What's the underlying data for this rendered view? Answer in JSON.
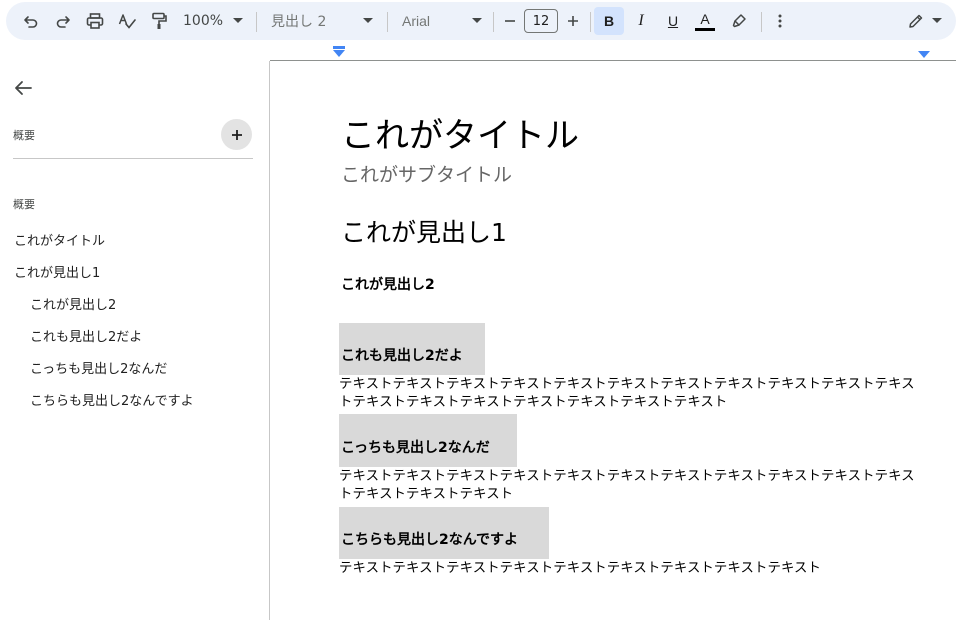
{
  "toolbar": {
    "zoom": "100%",
    "style": "見出し 2",
    "font": "Arial",
    "font_size": "12",
    "bold": "B",
    "italic": "I",
    "underline": "U",
    "text_color": "A",
    "colors": {
      "background": "#edf2fa",
      "bold_active": "#d3e3fd",
      "text_color_bar": "#000000"
    }
  },
  "sidebar": {
    "summary_heading": "概要",
    "outline_heading": "概要",
    "outline": [
      {
        "label": "これがタイトル",
        "level": 1
      },
      {
        "label": "これが見出し1",
        "level": 1
      },
      {
        "label": "これが見出し2",
        "level": 2
      },
      {
        "label": "これも見出し2だよ",
        "level": 2
      },
      {
        "label": "こっちも見出し2なんだ",
        "level": 2
      },
      {
        "label": "こちらも見出し2なんですよ",
        "level": 2
      }
    ]
  },
  "document": {
    "title": "これがタイトル",
    "subtitle": "これがサブタイトル",
    "heading1": "これが見出し1",
    "heading2": "これが見出し2",
    "sections": [
      {
        "heading": "これも見出し2だよ",
        "body": "テキストテキストテキストテキストテキストテキストテキストテキストテキストテキストテキストテキストテキストテキストテキストテキストテキストテキスト"
      },
      {
        "heading": "こっちも見出し2なんだ",
        "body": "テキストテキストテキストテキストテキストテキストテキストテキストテキストテキストテキストテキストテキストテキスト"
      },
      {
        "heading": "こちらも見出し2なんですよ",
        "body": "テキストテキストテキストテキストテキストテキストテキストテキストテキスト"
      }
    ],
    "highlight_color": "#d9d9d9"
  }
}
